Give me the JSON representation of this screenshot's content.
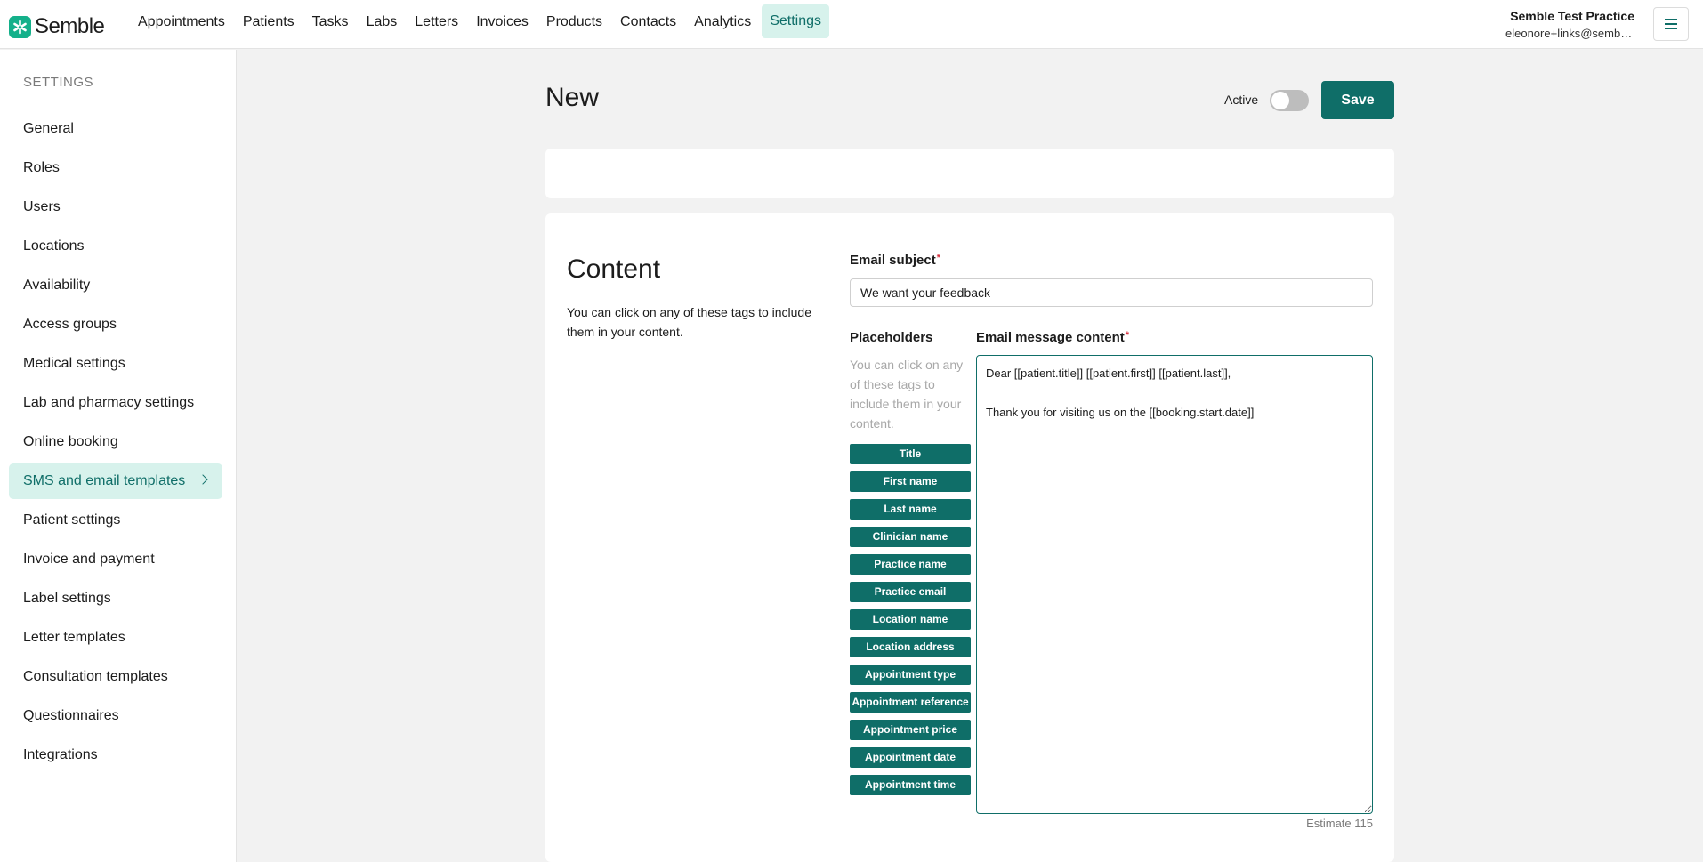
{
  "brand": {
    "name": "Semble",
    "accent": "#0f6e68",
    "logo_color": "#14b08a"
  },
  "nav": {
    "items": [
      "Appointments",
      "Patients",
      "Tasks",
      "Labs",
      "Letters",
      "Invoices",
      "Products",
      "Contacts",
      "Analytics",
      "Settings"
    ],
    "active": "Settings"
  },
  "account": {
    "practice": "Semble Test Practice",
    "email": "eleonore+links@semble.io"
  },
  "sidebar": {
    "heading": "SETTINGS",
    "items": [
      {
        "label": "General"
      },
      {
        "label": "Roles"
      },
      {
        "label": "Users"
      },
      {
        "label": "Locations"
      },
      {
        "label": "Availability"
      },
      {
        "label": "Access groups"
      },
      {
        "label": "Medical settings"
      },
      {
        "label": "Lab and pharmacy settings"
      },
      {
        "label": "Online booking"
      },
      {
        "label": "SMS and email templates"
      },
      {
        "label": "Patient settings"
      },
      {
        "label": "Invoice and payment"
      },
      {
        "label": "Label settings"
      },
      {
        "label": "Letter templates"
      },
      {
        "label": "Consultation templates"
      },
      {
        "label": "Questionnaires"
      },
      {
        "label": "Integrations"
      }
    ],
    "active": "SMS and email templates"
  },
  "header": {
    "title": "New",
    "active_label": "Active",
    "active_on": false,
    "save_label": "Save"
  },
  "content": {
    "title": "Content",
    "description": "You can click on any of these tags to include them in your content.",
    "subject_label": "Email subject",
    "subject_value": "We want your feedback",
    "placeholders_label": "Placeholders",
    "placeholders_hint": "You can click on any of these tags to include them in your content.",
    "tags": [
      "Title",
      "First name",
      "Last name",
      "Clinician name",
      "Practice name",
      "Practice email",
      "Location name",
      "Location address",
      "Appointment type",
      "Appointment reference",
      "Appointment price",
      "Appointment date",
      "Appointment time"
    ],
    "message_label": "Email message content",
    "message_value": "Dear [[patient.title]] [[patient.first]] [[patient.last]],\n\nThank you for visiting us on the [[booking.start.date]]",
    "estimate": "Estimate 115"
  }
}
